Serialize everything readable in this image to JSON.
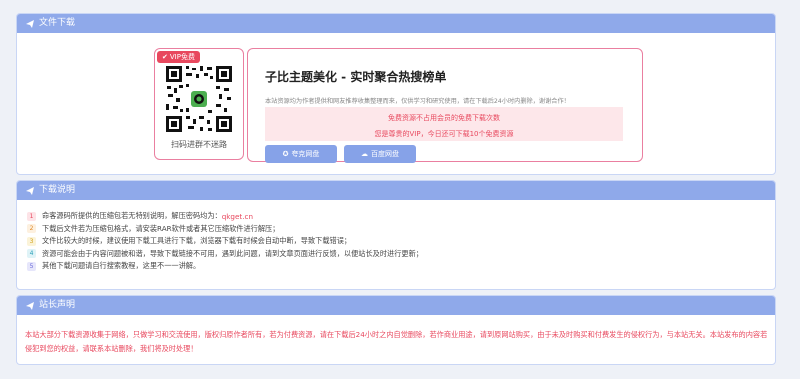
{
  "download": {
    "header": "文件下载",
    "vip_tag": "VIP免费",
    "qr_caption": "扫码进群不迷路",
    "title": "子比主题美化 - 实时聚合热搜榜单",
    "desc": "本站资源均为作者提供和网友推荐收集整理而来，仅供学习和研究使用，请在下载后24小时内删除，谢谢合作！",
    "notice1": "免费资源不占用会员的免费下载次数",
    "notice2": "您是尊贵的VIP，今日还可下载10个免费资源",
    "button1": "夸克网盘",
    "button2": "百度网盘"
  },
  "notes": {
    "header": "下载说明",
    "items": [
      {
        "num": "1",
        "text": "命客源码所提供的压缩包若无特别说明，解压密码均为：",
        "link": "qkget.cn",
        "color": "#e8485e",
        "bg": "#fde3e7"
      },
      {
        "num": "2",
        "text": "下载后文件若为压缩包格式，请安装RAR软件或者其它压缩软件进行解压；",
        "link": "",
        "color": "#e08a2a",
        "bg": "#fdf0df"
      },
      {
        "num": "3",
        "text": "文件比较大的时候，建议使用下载工具进行下载，浏览器下载有时候会自动中断，导致下载错误；",
        "link": "",
        "color": "#d2a21a",
        "bg": "#fbf3d8"
      },
      {
        "num": "4",
        "text": "资源可能会由于内容问题被和谐，导致下载链接不可用，遇到此问题，请到文章页面进行反馈，以便站长及时进行更新；",
        "link": "",
        "color": "#2aa0b8",
        "bg": "#dff3f7"
      },
      {
        "num": "5",
        "text": "其他下载问题请自行搜索教程，这里不一一讲解。",
        "link": "",
        "color": "#6b6bd8",
        "bg": "#e6e6fb"
      }
    ]
  },
  "statement": {
    "header": "站长声明",
    "text": "本站大部分下载资源收集于网络，只做学习和交流使用，版权归原作者所有，若为付费资源，请在下载后24小时之内自觉删除，若作商业用途，请到原网站购买，由于未及时购买和付费发生的侵权行为，与本站无关。本站发布的内容若侵犯到您的权益，请联系本站删除，我们将及时处理！"
  }
}
